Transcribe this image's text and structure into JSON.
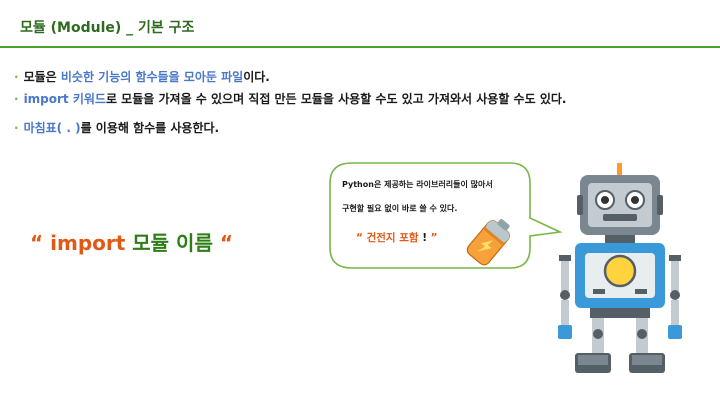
{
  "header": {
    "title": "모듈 (Module) _ 기본 구조"
  },
  "bullets": {
    "b1": {
      "part1": "모듈은 ",
      "hl": "비슷한 기능의 함수들을 모아둔 파일",
      "part2": "이다."
    },
    "b2": {
      "hl": "import 키워드",
      "part2": "로 모듈을 가져올 수 있으며 직접 만든 모듈을 사용할 수도 있고 가져와서 사용할 수도 있다."
    },
    "b3": {
      "hl": "마침표( . )",
      "part2": "를 이용해 함수를 사용한다."
    }
  },
  "formula": {
    "open_quote": "“",
    "keyword": "import",
    "module": "모듈 이름",
    "close_quote": "“"
  },
  "bubble": {
    "line1": "Python은 제공하는 라이브러리들이 많아서",
    "line2": "구현할 필요 없이 바로 쓸 수 있다.",
    "line3_open": "“",
    "line3_text": "건전지 포함",
    "line3_ex": "!",
    "line3_close": "”"
  },
  "colors": {
    "accent_green": "#4aa02c",
    "title_green": "#2e6b1f",
    "highlight_blue": "#4a78c8",
    "orange": "#e05a17",
    "robot_blue": "#3a9ad9"
  },
  "icons": [
    "battery-icon",
    "robot-illustration"
  ]
}
